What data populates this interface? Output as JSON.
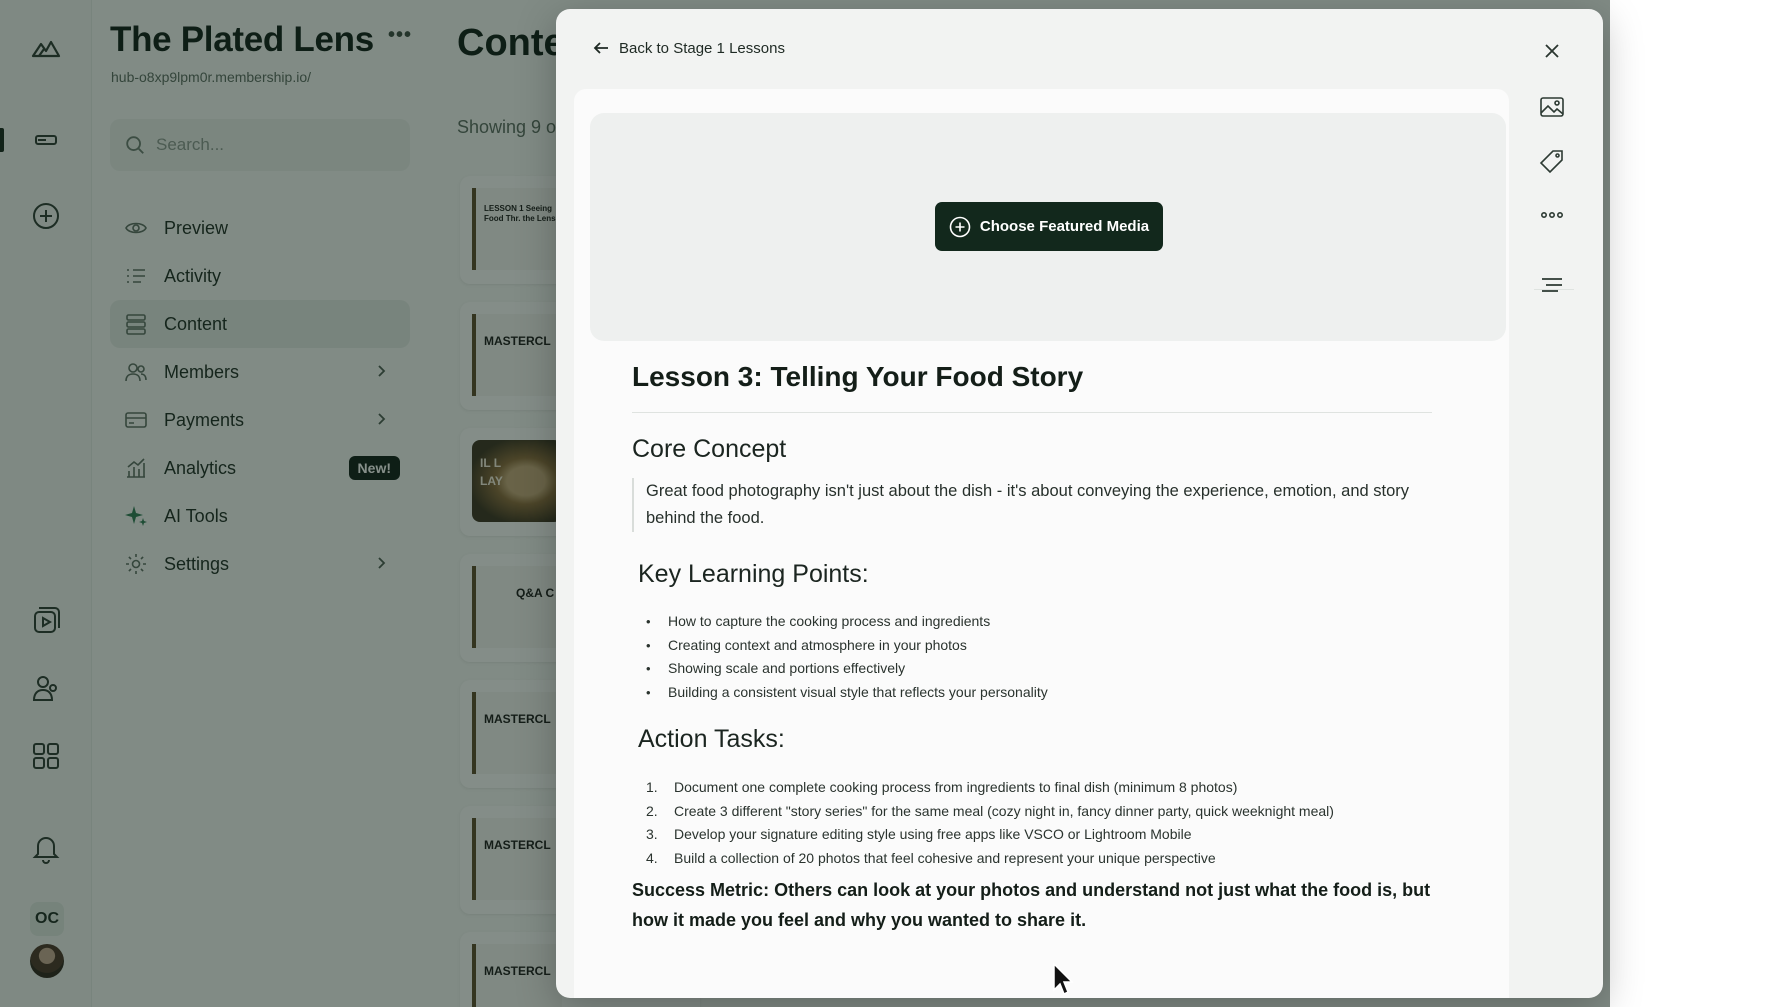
{
  "sidebar": {
    "brand_title": "The Plated Lens",
    "brand_more": "•••",
    "brand_url": "hub-o8xp9lpm0r.membership.io/",
    "search_placeholder": "Search...",
    "items": [
      {
        "label": "Preview",
        "icon": "eye-icon"
      },
      {
        "label": "Activity",
        "icon": "activity-list-icon"
      },
      {
        "label": "Content",
        "icon": "content-stack-icon",
        "active": true
      },
      {
        "label": "Members",
        "icon": "members-icon",
        "chevron": true
      },
      {
        "label": "Payments",
        "icon": "credit-card-icon",
        "chevron": true
      },
      {
        "label": "Analytics",
        "icon": "analytics-chart-icon",
        "badge": "New!"
      },
      {
        "label": "AI Tools",
        "icon": "sparkle-icon"
      },
      {
        "label": "Settings",
        "icon": "gear-icon",
        "chevron": true
      }
    ]
  },
  "rail": {
    "initials": "OC"
  },
  "content": {
    "title": "Conte",
    "showing": "Showing 9 o",
    "thumbnails": [
      "LESSON 1 Seeing Food Thr. the Lens",
      "MASTERCL",
      "IL L LAY",
      "Q&A C",
      "MASTERCL",
      "MASTERCL",
      "MASTERCL"
    ]
  },
  "modal": {
    "back_label": "Back to Stage 1 Lessons",
    "media_button": "Choose Featured Media",
    "lesson_title": "Lesson 3: Telling Your Food Story",
    "core_heading": "Core Concept",
    "core_quote": "Great food photography isn't just about the dish - it's about conveying the experience, emotion, and story behind the food.",
    "points_heading": "Key Learning Points:",
    "points": [
      "How to capture the cooking process and ingredients",
      "Creating context and atmosphere in your photos",
      "Showing scale and portions effectively",
      "Building a consistent visual style that reflects your personality"
    ],
    "tasks_heading": "Action Tasks:",
    "tasks": [
      {
        "num": "1.",
        "text": "Document one complete cooking process from ingredients to final dish (minimum 8 photos)"
      },
      {
        "num": "2.",
        "text": "Create 3 different \"story series\" for the same meal (cozy night in, fancy dinner party, quick weeknight meal)"
      },
      {
        "num": "3.",
        "text": "Develop your signature editing style using free apps like VSCO or Lightroom Mobile"
      },
      {
        "num": "4.",
        "text": "Build a collection of 20 photos that feel cohesive and represent your unique perspective"
      }
    ],
    "success_metric": "Success Metric: Others can look at your photos and understand not just what the food is, but how it made you feel and why you wanted to share it.",
    "tools": [
      "image-icon",
      "tag-icon",
      "more-dots-icon",
      "align-icon"
    ]
  },
  "colors": {
    "brand_dark": "#12281c",
    "overlay": "#0e2016"
  }
}
